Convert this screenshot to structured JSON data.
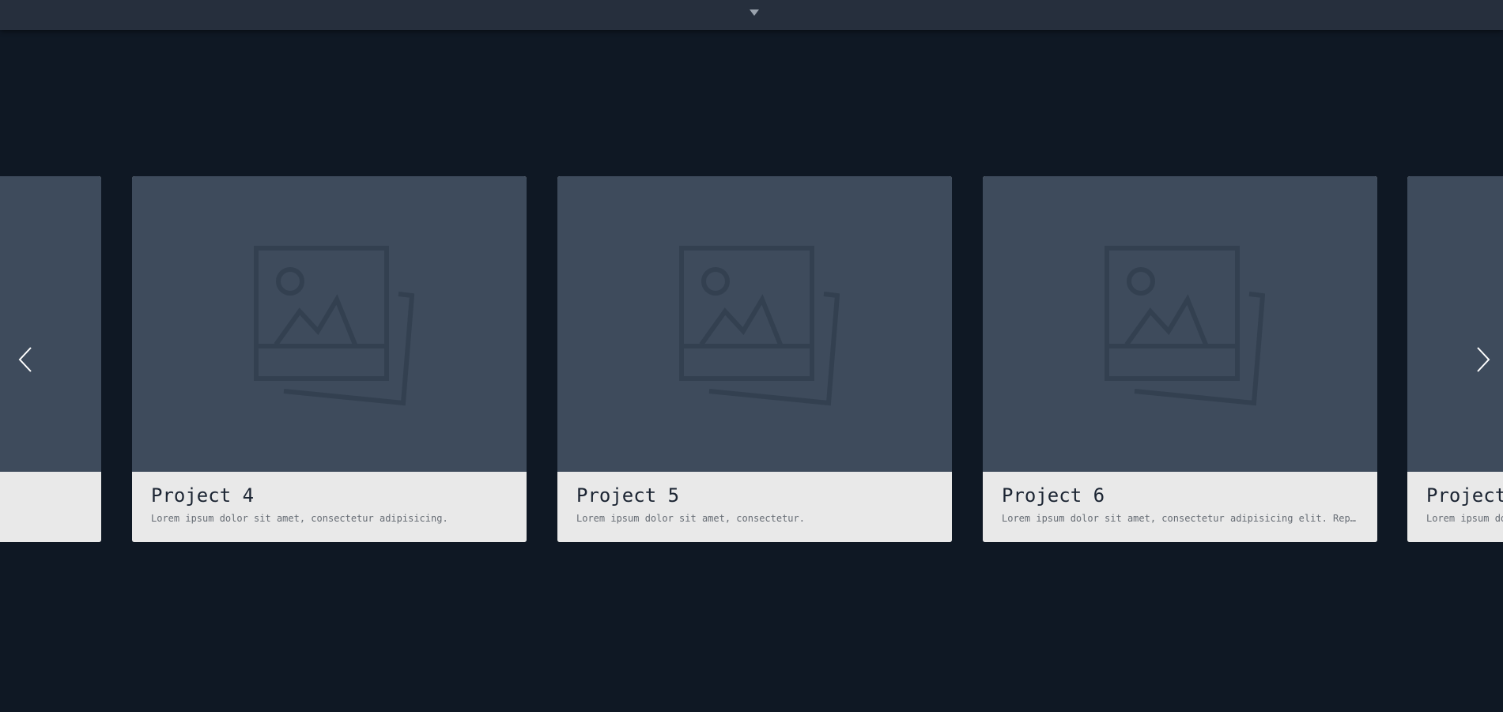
{
  "top_bar": {
    "toggle_icon": "caret-down-icon"
  },
  "carousel": {
    "prev_icon": "chevron-left-icon",
    "next_icon": "chevron-right-icon",
    "image_placeholder_icon": "image-placeholder-icon",
    "cards": [
      {
        "title": "",
        "description": ""
      },
      {
        "title": "Project 4",
        "description": "Lorem ipsum dolor sit amet, consectetur adipisicing."
      },
      {
        "title": "Project 5",
        "description": "Lorem ipsum dolor sit amet, consectetur."
      },
      {
        "title": "Project 6",
        "description": "Lorem ipsum dolor sit amet, consectetur adipisicing elit. Rep…"
      },
      {
        "title": "Project",
        "description": "Lorem ipsum do"
      }
    ]
  },
  "colors": {
    "page_background": "#0f1824",
    "top_bar": "#262f3d",
    "card_media": "#3e4b5c",
    "card_body": "#e9e9e9",
    "card_title": "#1c2533",
    "card_description": "#666c74"
  }
}
